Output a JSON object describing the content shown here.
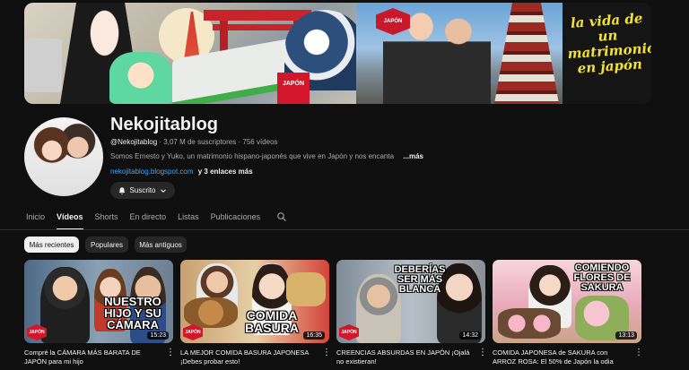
{
  "banner": {
    "script_text": "la vida de un matrimonio en japón",
    "logo_text": "JAPÓN"
  },
  "channel": {
    "name": "Nekojitablog",
    "handle": "@Nekojitablog",
    "subscribers": "3,07 M de suscriptores",
    "videos": "756 vídeos",
    "separator": "·",
    "description": "Somos Ernesto y Yuko, un matrimonio hispano-japonés que vive en Japón y nos encanta",
    "more": "...más",
    "link": "nekojitablog.blogspot.com",
    "extra_links": "y 3 enlaces más",
    "subscribe_label": "Suscrito"
  },
  "tabs": [
    "Inicio",
    "Vídeos",
    "Shorts",
    "En directo",
    "Listas",
    "Publicaciones"
  ],
  "active_tab": "Vídeos",
  "chips": [
    "Más recientes",
    "Populares",
    "Más antiguos"
  ],
  "videos": [
    {
      "title": "Compré la CÁMARA MÁS BARATA DE JAPÓN para mi hijo",
      "duration": "15:23",
      "overlay": "NUESTRO HIJO Y SU CÁMARA"
    },
    {
      "title": "LA MEJOR COMIDA BASURA JAPONESA ¡Debes probar esto!",
      "duration": "16:35",
      "overlay": "COMIDA BASURA"
    },
    {
      "title": "CREENCIAS ABSURDAS EN JAPÓN ¡Ojalá no existieran!",
      "duration": "14:32",
      "overlay": "DEBERÍAS SER MÁS BLANCA"
    },
    {
      "title": "COMIDA JAPONESA de SAKURA con ARROZ ROSA: El 50% de Japón la odia",
      "duration": "13:13",
      "overlay": "COMIENDO FLORES DE SAKURA"
    }
  ],
  "colors": {
    "background": "#0f0f0f",
    "link": "#3ea6ff",
    "accent_red": "#d4162a"
  }
}
